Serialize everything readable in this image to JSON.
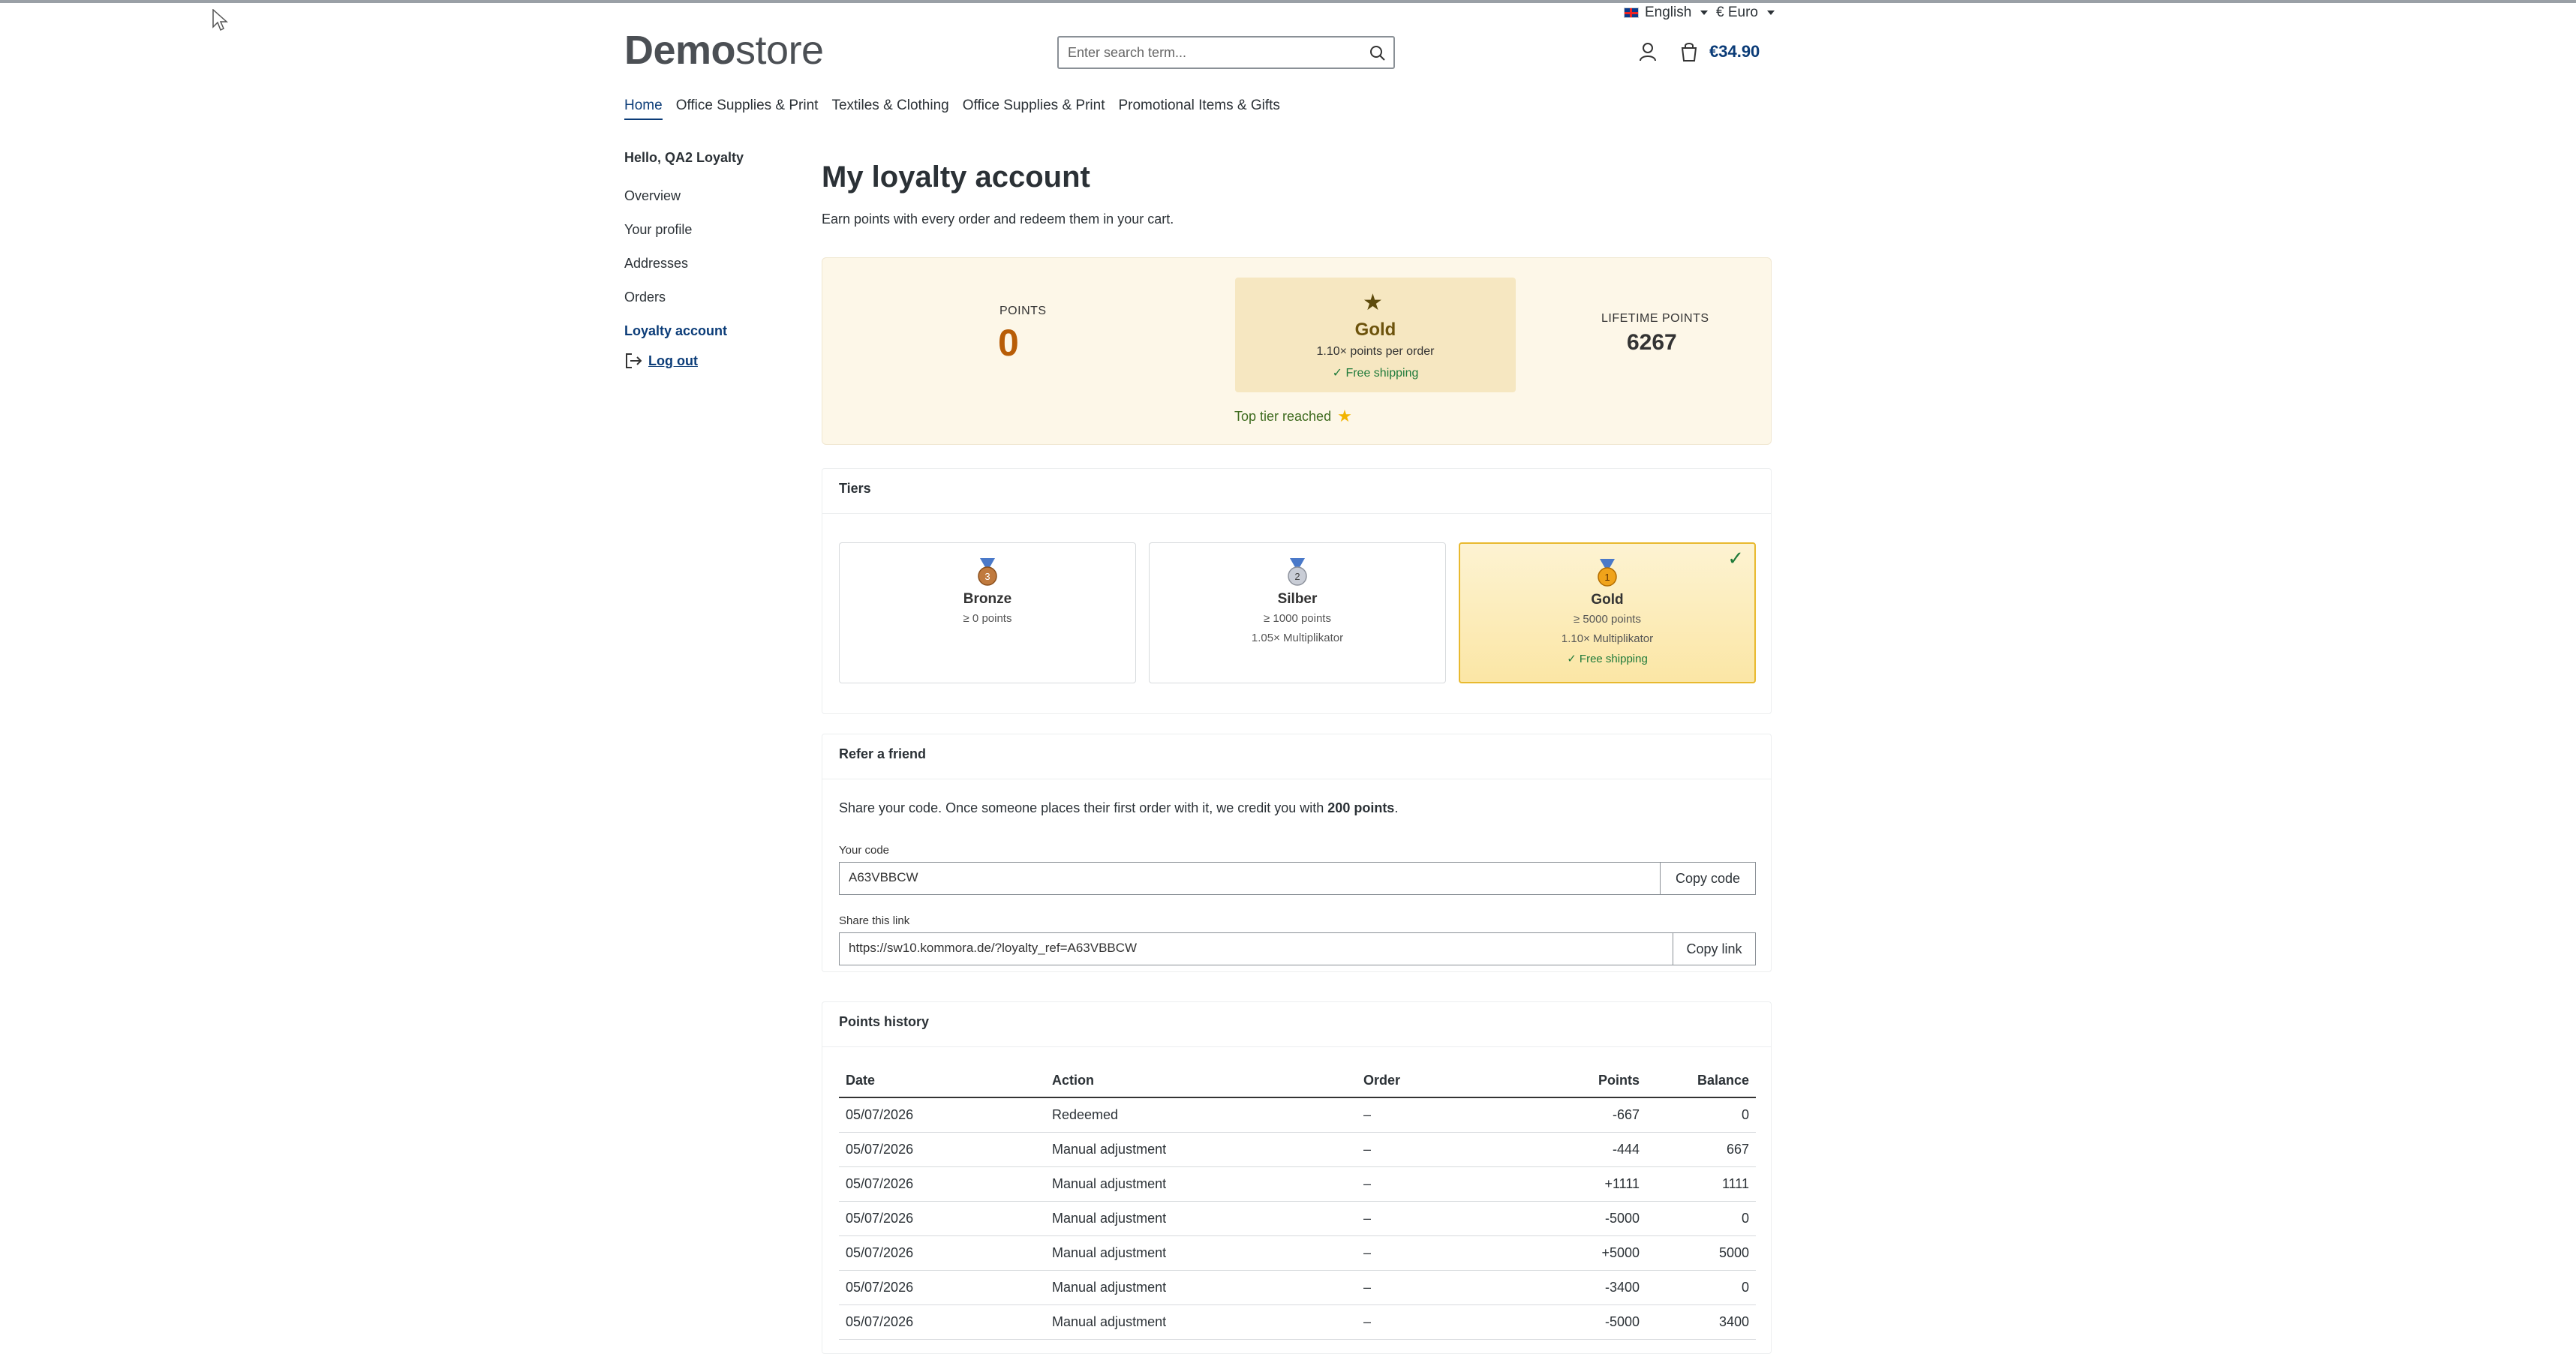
{
  "header": {
    "language": "English",
    "currency": "€ Euro",
    "logo_bold": "Demo",
    "logo_light": "store",
    "search_placeholder": "Enter search term...",
    "cart_total": "€34.90"
  },
  "nav": [
    "Home",
    "Office Supplies & Print",
    "Textiles & Clothing",
    "Office Supplies & Print",
    "Promotional Items & Gifts"
  ],
  "sidebar": {
    "greeting": "Hello, QA2 Loyalty",
    "items": [
      "Overview",
      "Your profile",
      "Addresses",
      "Orders",
      "Loyalty account"
    ],
    "logout": "Log out"
  },
  "main": {
    "title": "My loyalty account",
    "subtitle": "Earn points with every order and redeem them in your cart.",
    "summary": {
      "points_label": "POINTS",
      "points": "0",
      "tier": "Gold",
      "multiplier": "1.10× points per order",
      "shipping": "✓ Free shipping",
      "top_tier": "Top tier reached",
      "lifetime_label": "LIFETIME POINTS",
      "lifetime": "6267"
    },
    "tiers": {
      "heading": "Tiers",
      "items": [
        {
          "medal": "3",
          "name": "Bronze",
          "min": "≥ 0 points",
          "mult": "",
          "ship": ""
        },
        {
          "medal": "2",
          "name": "Silber",
          "min": "≥ 1000 points",
          "mult": "1.05× Multiplikator",
          "ship": ""
        },
        {
          "medal": "1",
          "name": "Gold",
          "min": "≥ 5000 points",
          "mult": "1.10× Multiplikator",
          "ship": "✓ Free shipping"
        }
      ]
    },
    "refer": {
      "heading": "Refer a friend",
      "text_before": "Share your code. Once someone places their first order with it, we credit you with ",
      "text_bold": "200 points",
      "text_after": ".",
      "code_label": "Your code",
      "code": "A63VBBCW",
      "copy_code": "Copy code",
      "link_label": "Share this link",
      "link": "https://sw10.kommora.de/?loyalty_ref=A63VBBCW",
      "copy_link": "Copy link"
    },
    "history": {
      "heading": "Points history",
      "columns": [
        "Date",
        "Action",
        "Order",
        "Points",
        "Balance"
      ],
      "rows": [
        [
          "05/07/2026",
          "Redeemed",
          "–",
          "-667",
          "0"
        ],
        [
          "05/07/2026",
          "Manual adjustment",
          "–",
          "-444",
          "667"
        ],
        [
          "05/07/2026",
          "Manual adjustment",
          "–",
          "+1111",
          "1111"
        ],
        [
          "05/07/2026",
          "Manual adjustment",
          "–",
          "-5000",
          "0"
        ],
        [
          "05/07/2026",
          "Manual adjustment",
          "–",
          "+5000",
          "5000"
        ],
        [
          "05/07/2026",
          "Manual adjustment",
          "–",
          "-3400",
          "0"
        ],
        [
          "05/07/2026",
          "Manual adjustment",
          "–",
          "-5000",
          "3400"
        ]
      ]
    }
  },
  "colors": {
    "accent": "#0b3c78",
    "points": "#b85d07",
    "gold_bg": "#f6e7c1",
    "success": "#1f7a3a"
  }
}
